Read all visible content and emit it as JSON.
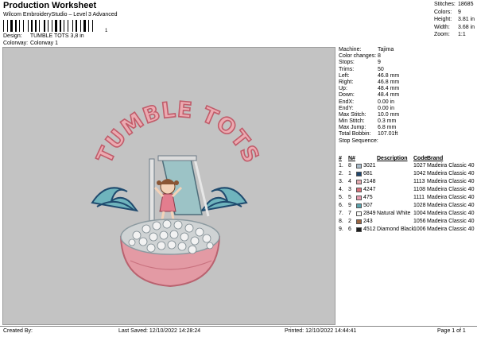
{
  "header": {
    "title": "Production Worksheet",
    "subtitle": "Wilcom EmbroideryStudio – Level 3 Advanced",
    "barcode_tail": "1",
    "design_label": "Design:",
    "design_value": "TUMBLE TOTS 3,8 in",
    "colorway_label": "Colorway:",
    "colorway_value": "Colorway 1"
  },
  "stats": [
    {
      "k": "Stitches:",
      "v": "18685"
    },
    {
      "k": "Colors:",
      "v": "9"
    },
    {
      "k": "Height:",
      "v": "3.81 in"
    },
    {
      "k": "Width:",
      "v": "3.68 in"
    },
    {
      "k": "Zoom:",
      "v": "1:1"
    }
  ],
  "machine_info": [
    {
      "k": "Machine:",
      "v": "Tajima"
    },
    {
      "k": "Color changes:",
      "v": "8"
    },
    {
      "k": "Stops:",
      "v": "9"
    },
    {
      "k": "Trims:",
      "v": "50"
    },
    {
      "k": "Left:",
      "v": "46.8 mm"
    },
    {
      "k": "Right:",
      "v": "46.8 mm"
    },
    {
      "k": "Up:",
      "v": "48.4 mm"
    },
    {
      "k": "Down:",
      "v": "48.4 mm"
    },
    {
      "k": "EndX:",
      "v": "0.00 in"
    },
    {
      "k": "EndY:",
      "v": "0.00 in"
    },
    {
      "k": "Max Stitch:",
      "v": "10.0 mm"
    },
    {
      "k": "Min Stitch:",
      "v": "0.3 mm"
    },
    {
      "k": "Max Jump:",
      "v": "6.8 mm"
    },
    {
      "k": "Total Bobbin:",
      "v": "107.01ft"
    },
    {
      "k": "Stop Sequence:",
      "v": ""
    }
  ],
  "sequence": {
    "headers": {
      "idx": "#",
      "n": "N#",
      "num": "",
      "desc": "Description",
      "code": "Code",
      "brand": "Brand"
    },
    "rows": [
      {
        "idx": "1.",
        "n": "8",
        "color": "#a9bccb",
        "num": "3021",
        "desc": "",
        "code": "1027",
        "brand": "Madeira Classic 40"
      },
      {
        "idx": "2.",
        "n": "1",
        "color": "#20466e",
        "num": "681",
        "desc": "",
        "code": "1042",
        "brand": "Madeira Classic 40"
      },
      {
        "idx": "3.",
        "n": "4",
        "color": "#e3a9ae",
        "num": "2148",
        "desc": "",
        "code": "1113",
        "brand": "Madeira Classic 40"
      },
      {
        "idx": "4.",
        "n": "3",
        "color": "#d86f78",
        "num": "4247",
        "desc": "",
        "code": "1108",
        "brand": "Madeira Classic 40"
      },
      {
        "idx": "5.",
        "n": "5",
        "color": "#e89db0",
        "num": "475",
        "desc": "",
        "code": "1111",
        "brand": "Madeira Classic 40"
      },
      {
        "idx": "6.",
        "n": "9",
        "color": "#5ba3ad",
        "num": "507",
        "desc": "",
        "code": "1028",
        "brand": "Madeira Classic 40"
      },
      {
        "idx": "7.",
        "n": "7",
        "color": "#f7f7f4",
        "num": "2849",
        "desc": "Natural White",
        "code": "1004",
        "brand": "Madeira Classic 40"
      },
      {
        "idx": "8.",
        "n": "2",
        "color": "#9a6542",
        "num": "243",
        "desc": "",
        "code": "1056",
        "brand": "Madeira Classic 40"
      },
      {
        "idx": "9.",
        "n": "6",
        "color": "#1e1e1e",
        "num": "4512",
        "desc": "Diamond Black",
        "code": "1006",
        "brand": "Madeira Classic 40"
      }
    ]
  },
  "artwork": {
    "text": "TUMBLE TOTS"
  },
  "footer": {
    "created_by": "Created By:",
    "last_saved": "Last Saved: 12/10/2022 14:28:24",
    "printed": "Printed: 12/10/2022 14:44:41",
    "page": "Page 1 of 1"
  }
}
